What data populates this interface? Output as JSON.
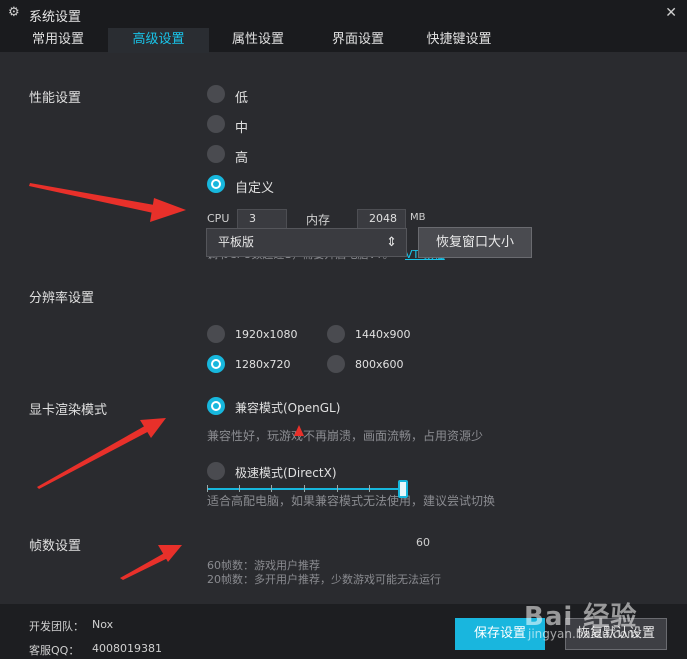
{
  "window": {
    "title": "系统设置",
    "gear_icon": "gear-icon",
    "close_icon": "✕"
  },
  "tabs": [
    {
      "label": "常用设置",
      "active": false
    },
    {
      "label": "高级设置",
      "active": true
    },
    {
      "label": "属性设置",
      "active": false
    },
    {
      "label": "界面设置",
      "active": false
    },
    {
      "label": "快捷键设置",
      "active": false
    }
  ],
  "performance": {
    "label": "性能设置",
    "options": [
      "低",
      "中",
      "高",
      "自定义"
    ],
    "selected": "自定义",
    "cpu_label": "CPU",
    "cpu_value": "3",
    "memory_label": "内存",
    "memory_value": "2048",
    "memory_unit": "MB",
    "hint": "调节CPU数超过1，需要开启电脑VT。",
    "vt_link": "VT 教程"
  },
  "resolution": {
    "label": "分辨率设置",
    "select_value": "平板版",
    "restore_button": "恢复窗口大小",
    "options": [
      "1920x1080",
      "1440x900",
      "1280x720",
      "800x600"
    ],
    "selected": "1280x720"
  },
  "render": {
    "label": "显卡渲染模式",
    "compat_label": "兼容模式(OpenGL)",
    "compat_hint": "兼容性好，玩游戏不再崩溃，画面流畅，占用资源少",
    "speed_label": "极速模式(DirectX)",
    "speed_hint": "适合高配电脑，如果兼容模式无法使用，建议尝试切换",
    "selected": "兼容模式(OpenGL)"
  },
  "fps": {
    "label": "帧数设置",
    "value": "60",
    "hint1": "60帧数：游戏用户推荐",
    "hint2": "20帧数：多开用户推荐，少数游戏可能无法运行"
  },
  "footer": {
    "team_label": "开发团队：",
    "team_value": "Nox",
    "qq_label": "客服QQ：",
    "qq_value": "4008019381",
    "save_button": "保存设置",
    "default_button": "恢复默认设置"
  },
  "watermark": {
    "text": "Bai 经验",
    "sub": "jingyan.baidu.com"
  },
  "colors": {
    "accent": "#17b7dd",
    "arrow": "#e8302a",
    "background": "#2a2b2f"
  }
}
